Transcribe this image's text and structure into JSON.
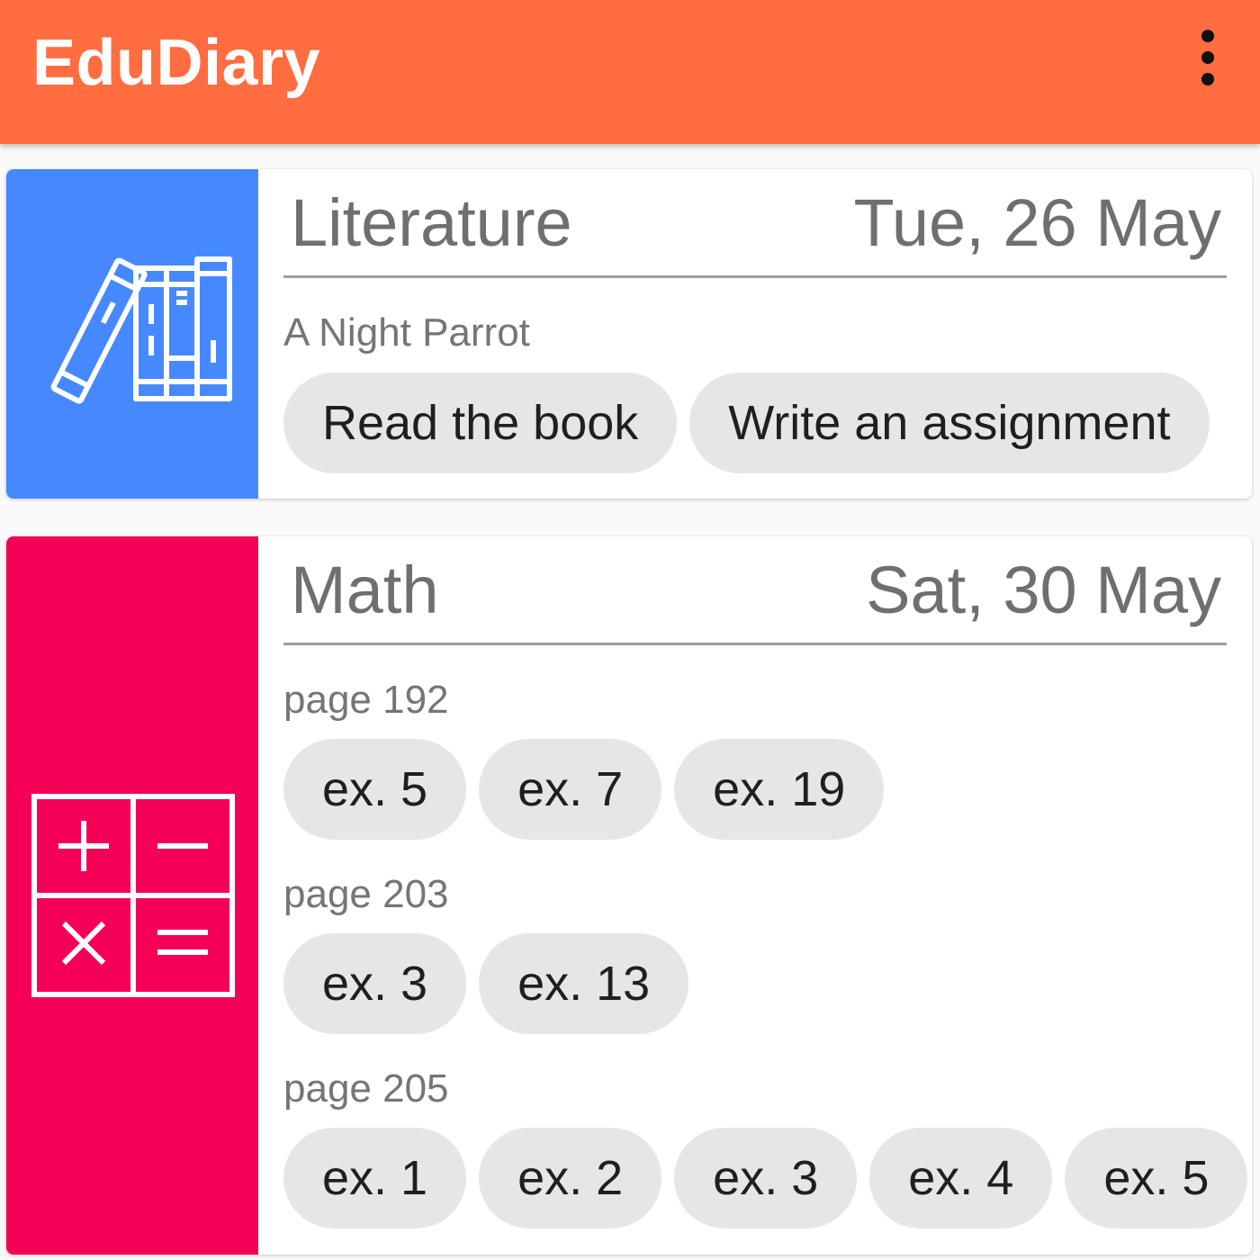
{
  "app": {
    "title": "EduDiary",
    "menu_icon": "more-vert-icon",
    "accent_color": "#FF6D40"
  },
  "cards": [
    {
      "subject": "Literature",
      "date": "Tue, 26 May",
      "icon": "books-icon",
      "color": "#4689FF",
      "sections": [
        {
          "label": "A Night Parrot",
          "items": [
            "Read the book",
            "Write an assignment"
          ]
        }
      ]
    },
    {
      "subject": "Math",
      "date": "Sat, 30 May",
      "icon": "calculator-icon",
      "color": "#F50057",
      "sections": [
        {
          "label": "page 192",
          "items": [
            "ex. 5",
            "ex. 7",
            "ex. 19"
          ]
        },
        {
          "label": "page 203",
          "items": [
            "ex. 3",
            "ex. 13"
          ]
        },
        {
          "label": "page 205",
          "items": [
            "ex. 1",
            "ex. 2",
            "ex. 3",
            "ex. 4",
            "ex. 5"
          ]
        }
      ]
    }
  ]
}
